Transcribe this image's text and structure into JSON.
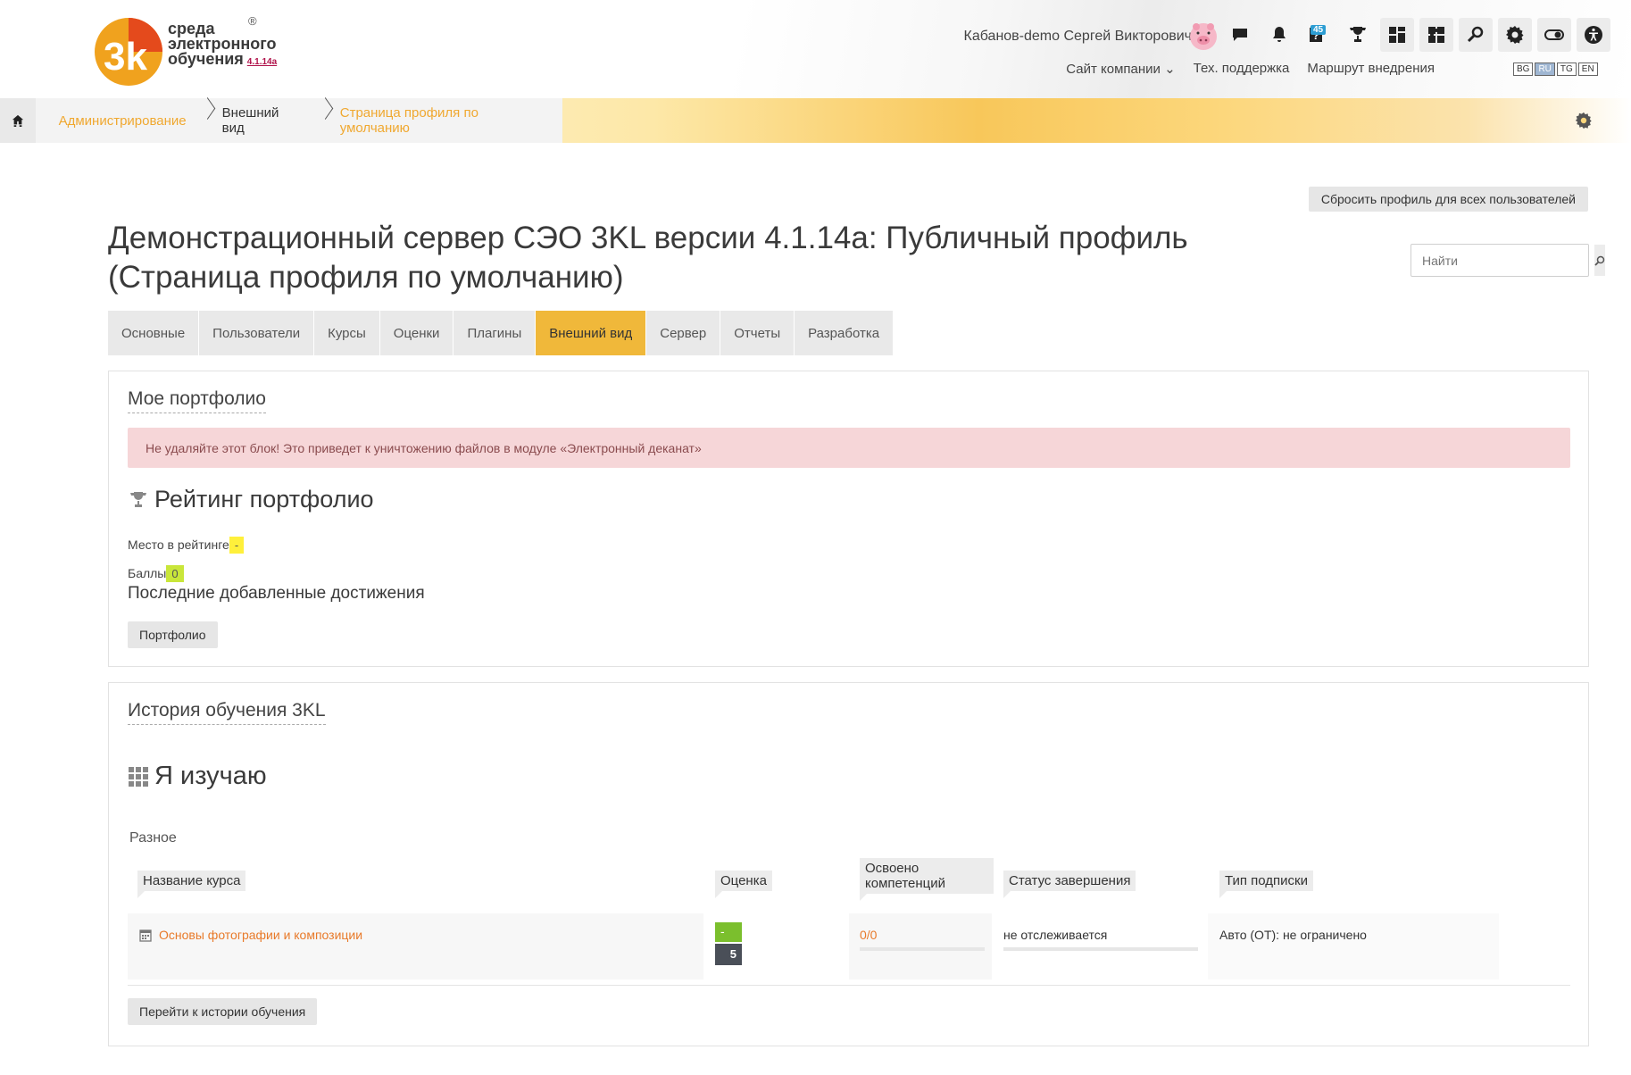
{
  "brand": {
    "registered": "®",
    "line1": "среда",
    "line2": "электронного",
    "line3": "обучения",
    "version": "4.1.14a",
    "accent": "#f0a830"
  },
  "header": {
    "user_name": "Кабанов-demo Сергей Викторович",
    "notif_count": "45",
    "links": {
      "company": "Сайт компании ⌄",
      "support": "Тех. поддержка",
      "route": "Маршрут внедрения"
    },
    "langs": [
      "BG",
      "RU",
      "TG",
      "EN"
    ],
    "active_lang": "RU",
    "icons": [
      "chat-icon",
      "bell-icon",
      "help-icon",
      "trophy-icon",
      "dashboard-icon",
      "puzzle-icon",
      "search-icon",
      "gear-icon",
      "toggle-icon",
      "accessibility-icon"
    ]
  },
  "breadcrumb": {
    "items": [
      "Администрирование",
      "Внешний вид",
      "Страница профиля по умолчанию"
    ]
  },
  "main": {
    "reset_button": "Сбросить профиль для всех пользователей",
    "title": "Демонстрационный сервер СЭО 3KL версии 4.1.14a: Публичный профиль (Страница профиля по умолчанию)",
    "search_placeholder": "Найти",
    "tabs": [
      "Основные",
      "Пользователи",
      "Курсы",
      "Оценки",
      "Плагины",
      "Внешний вид",
      "Сервер",
      "Отчеты",
      "Разработка"
    ],
    "active_tab": "Внешний вид"
  },
  "portfolio": {
    "title": "Мое портфолио",
    "alert": "Не удаляйте этот блок! Это приведет к уничтожению файлов в модуле «Электронный деканат»",
    "rating_title": "Рейтинг портфолио",
    "place_label": "Место в рейтинге",
    "place_value": "-",
    "points_label": "Баллы",
    "points_value": "0",
    "latest": "Последние добавленные достижения",
    "button": "Портфолио"
  },
  "history": {
    "title": "История обучения 3KL",
    "studying_title": "Я изучаю",
    "group": "Разное",
    "columns": {
      "name": "Название курса",
      "grade": "Оценка",
      "comp_line1": "Освоено",
      "comp_line2": "компетенций",
      "status": "Статус завершения",
      "sub": "Тип подписки"
    },
    "row": {
      "course": "Основы фотографии и композиции",
      "grade_top": "-",
      "grade_bottom": "5",
      "competencies": "0/0",
      "status": "не отслеживается",
      "subscription": "Авто (ОТ): не ограничено"
    },
    "button": "Перейти к истории обучения"
  }
}
